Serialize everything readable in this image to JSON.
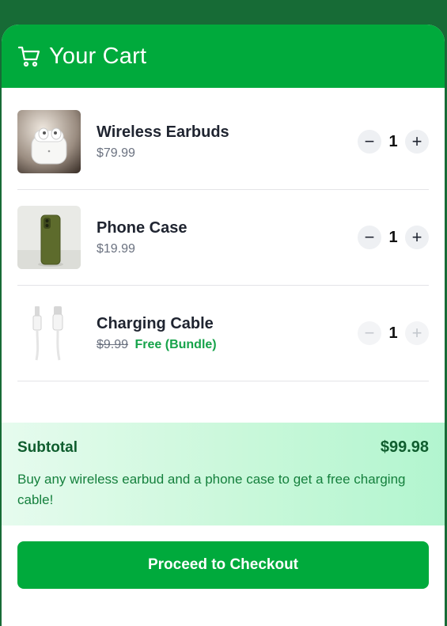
{
  "header": {
    "title": "Your Cart",
    "icon": "cart-icon"
  },
  "items": [
    {
      "name": "Wireless Earbuds",
      "price": "$79.99",
      "quantity": "1",
      "image": "earbuds-image"
    },
    {
      "name": "Phone Case",
      "price": "$19.99",
      "quantity": "1",
      "image": "phone-case-image"
    },
    {
      "name": "Charging Cable",
      "original_price": "$9.99",
      "free_label": "Free (Bundle)",
      "quantity": "1",
      "image": "cable-image"
    }
  ],
  "controls": {
    "minus": "−",
    "plus": "+"
  },
  "summary": {
    "subtotal_label": "Subtotal",
    "subtotal_value": "$99.98",
    "promo": "Buy any wireless earbud and a phone case to get a free charging cable!"
  },
  "checkout_label": "Proceed to Checkout",
  "colors": {
    "brand": "#00aa3c",
    "background": "#176b36",
    "free": "#16a34a"
  }
}
